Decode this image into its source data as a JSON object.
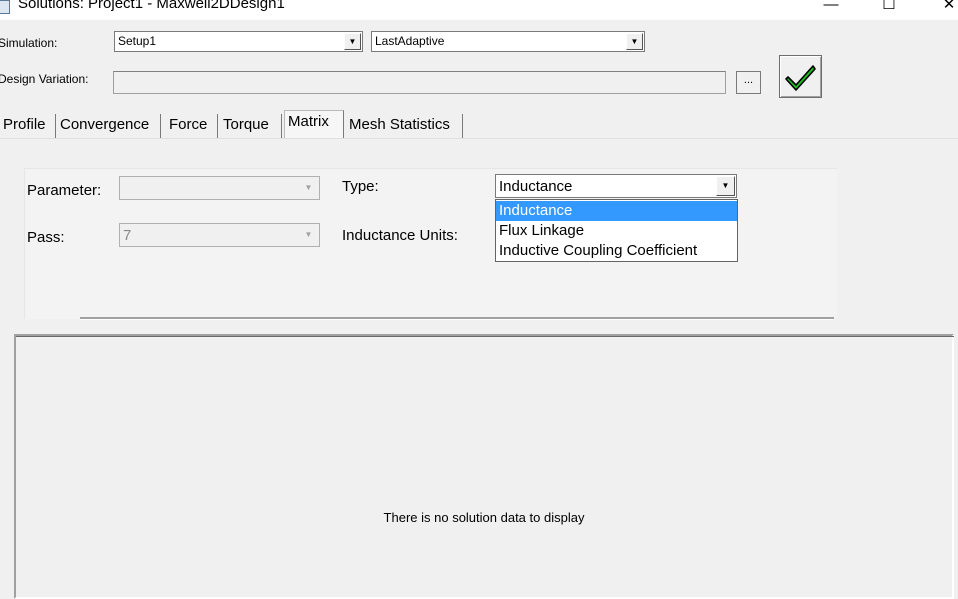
{
  "window": {
    "title": "Solutions: Project1 - Maxwell2DDesign1",
    "controls": {
      "minimize": "—",
      "maximize": "☐",
      "close": "✕"
    }
  },
  "simulation": {
    "label": "Simulation:",
    "setup": "Setup1",
    "pass": "LastAdaptive"
  },
  "design_variation": {
    "label": "Design Variation:",
    "value": "",
    "browse_label": "..."
  },
  "apply": {
    "icon": "green-check-icon"
  },
  "tabs": [
    {
      "label": "Profile",
      "active": false
    },
    {
      "label": "Convergence",
      "active": false
    },
    {
      "label": "Force",
      "active": false
    },
    {
      "label": "Torque",
      "active": false
    },
    {
      "label": "Matrix",
      "active": true
    },
    {
      "label": "Mesh Statistics",
      "active": false
    }
  ],
  "matrix": {
    "parameter_label": "Parameter:",
    "parameter_value": "",
    "pass_label": "Pass:",
    "pass_value": "7",
    "type_label": "Type:",
    "type_value": "Inductance",
    "units_label": "Inductance Units:",
    "type_options": [
      {
        "label": "Inductance",
        "selected": true
      },
      {
        "label": "Flux Linkage",
        "selected": false
      },
      {
        "label": "Inductive Coupling Coefficient",
        "selected": false
      }
    ]
  },
  "data_area": {
    "message": "There is no solution data to display"
  },
  "colors": {
    "selection": "#3399ff",
    "check": "#1fc01f",
    "window_bg": "#f0f0f0"
  }
}
